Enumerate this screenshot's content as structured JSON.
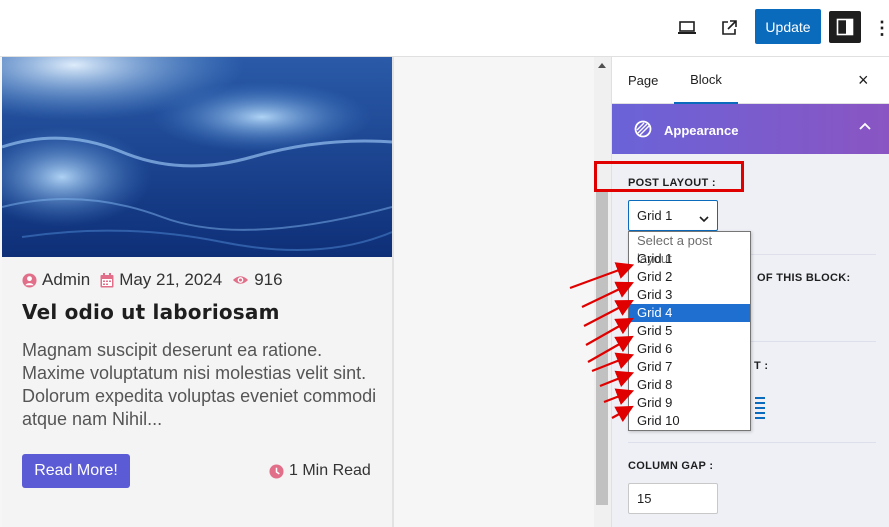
{
  "topbar": {
    "update_label": "Update",
    "icons": [
      "desktop-view-icon",
      "external-link-icon",
      "sidebar-toggle-icon",
      "more-options-icon"
    ]
  },
  "post": {
    "meta": {
      "author": "Admin",
      "date": "May 21, 2024",
      "views": "916"
    },
    "title": "Vel odio ut laboriosam",
    "excerpt": "Magnam suscipit deserunt ea ratione. Maxime voluptatum nisi molestias velit sint. Dolorum expedita voluptas eveniet commodi atque nam Nihil...",
    "read_more_label": "Read More!",
    "read_time": "1 Min Read"
  },
  "sidebar": {
    "tabs": [
      "Page",
      "Block"
    ],
    "active_tab": "Block",
    "close_label": "×",
    "panel_title": "Appearance",
    "post_layout_label": "POST LAYOUT :",
    "post_layout_value": "Grid 1",
    "hidden_label_1": "OF THIS BLOCK:",
    "hidden_label_2": "T :",
    "column_gap_label": "COLUMN GAP :",
    "column_gap_value": "15"
  },
  "dropdown": {
    "placeholder": "Select a post layout",
    "options": [
      "Grid 1",
      "Grid 2",
      "Grid 3",
      "Grid 4",
      "Grid 5",
      "Grid 6",
      "Grid 7",
      "Grid 8",
      "Grid 9",
      "Grid 10"
    ],
    "highlighted": "Grid 4"
  },
  "colors": {
    "accent": "#0a6bbd",
    "panel_gradient_start": "#6a63d8",
    "panel_gradient_end": "#8a55c2",
    "annotation_red": "#e10000",
    "read_more_bg": "#5b5bd6",
    "meta_icon": "#e26f8a"
  }
}
